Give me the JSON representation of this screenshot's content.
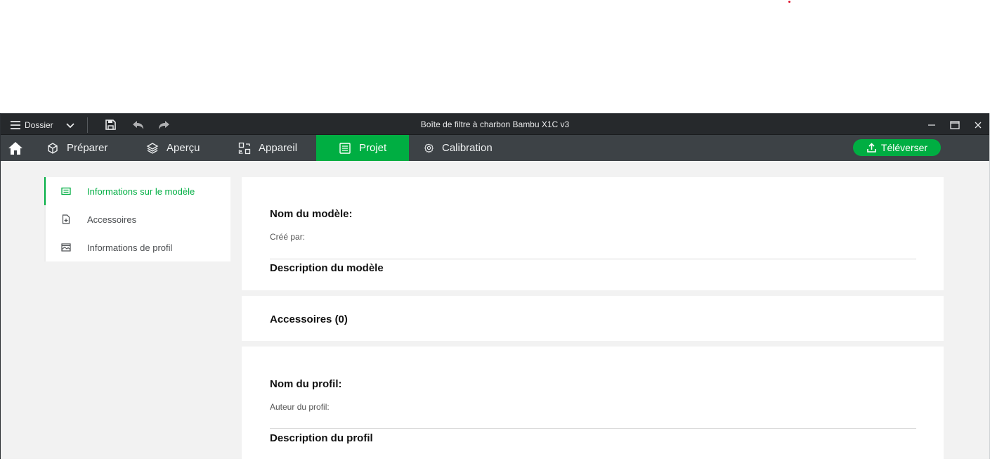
{
  "app": {
    "window_title": "Boîte de filtre à charbon Bambu X1C v3",
    "file_menu_label": "Dossier"
  },
  "nav": {
    "tabs": [
      {
        "label": "Préparer"
      },
      {
        "label": "Aperçu"
      },
      {
        "label": "Appareil"
      },
      {
        "label": "Projet"
      },
      {
        "label": "Calibration"
      }
    ],
    "active_tab": "Projet",
    "upload_label": "Téléverser"
  },
  "sidebar": {
    "items": [
      {
        "label": "Informations sur le modèle"
      },
      {
        "label": "Accessoires"
      },
      {
        "label": "Informations de profil"
      }
    ]
  },
  "model_section": {
    "name_label": "Nom du modèle:",
    "created_by_label": "Créé par:",
    "description_label": "Description du modèle"
  },
  "accessories_section": {
    "title": "Accessoires (0)"
  },
  "profile_section": {
    "name_label": "Nom du profil:",
    "author_label": "Auteur du profil:",
    "description_label": "Description du profil"
  },
  "colors": {
    "accent": "#00ae42",
    "titlebar": "#26292c",
    "navbar": "#3d4246",
    "background": "#f2f2f2"
  },
  "icons": {
    "file_menu": "hamburger-icon",
    "save": "save-icon",
    "undo": "undo-icon",
    "redo": "redo-icon",
    "home": "home-icon",
    "prepare": "cube-icon",
    "preview": "layers-icon",
    "device": "device-icon",
    "project": "project-icon",
    "calibration": "gear-icon",
    "upload": "upload-icon"
  }
}
